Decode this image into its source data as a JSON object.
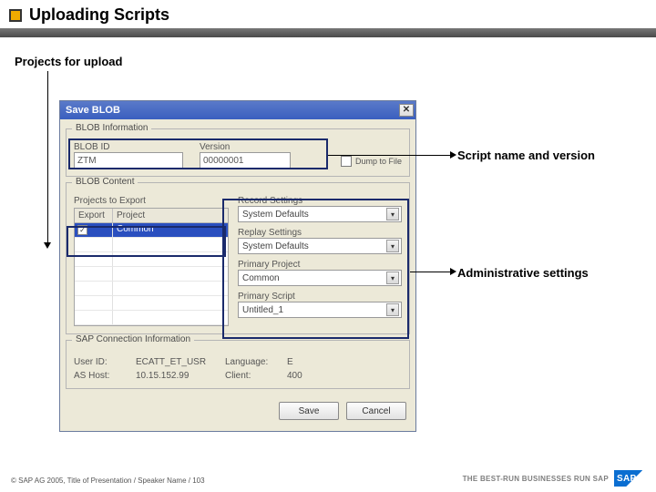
{
  "slide": {
    "title": "Uploading Scripts",
    "subheading": "Projects for upload"
  },
  "callouts": {
    "scriptNameVersion": "Script name and version",
    "adminSettings": "Administrative settings"
  },
  "dialog": {
    "title": "Save BLOB",
    "groupIdTitle": "BLOB Information",
    "blobIdLabel": "BLOB ID",
    "blobId": "ZTM",
    "versionLabel": "Version",
    "version": "00000001",
    "dumpToFile": "Dump to File",
    "groupContentTitle": "BLOB Content",
    "projectsLabel": "Projects to Export",
    "colExport": "Export",
    "colProject": "Project",
    "projRow": "Common",
    "recordSettings": "Record Settings",
    "recordSettingsVal": "System Defaults",
    "replaySettings": "Replay Settings",
    "replaySettingsVal": "System Defaults",
    "primaryProject": "Primary Project",
    "primaryProjectVal": "Common",
    "primaryScript": "Primary Script",
    "primaryScriptVal": "Untitled_1",
    "sapGroupTitle": "SAP Connection Information",
    "userIdLabel": "User ID:",
    "userId": "ECATT_ET_USR",
    "languageLabel": "Language:",
    "language": "E",
    "asHostLabel": "AS Host:",
    "asHost": "10.15.152.99",
    "clientLabel": "Client:",
    "client": "400",
    "saveBtn": "Save",
    "cancelBtn": "Cancel"
  },
  "footer": {
    "text": "© SAP AG 2005, Title of Presentation / Speaker Name / 103",
    "tagline": "THE BEST-RUN BUSINESSES RUN SAP",
    "logo": "SAP"
  }
}
